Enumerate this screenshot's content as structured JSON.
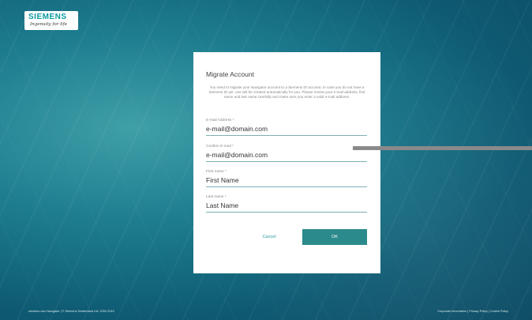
{
  "logo": {
    "word": "SIEMENS",
    "tagline": "Ingenuity for life"
  },
  "dialog": {
    "title": "Migrate Account",
    "description": "You need to migrate your Navigator account to a Siemens ID account. In case you do not have a Siemens ID yet, one will be created automatically for you. Please review your e-mail address, first name and last name carefully and make sure you enter a valid e-mail address.",
    "fields": [
      {
        "label": "E-mail Address *",
        "value": "e-mail@domain.com"
      },
      {
        "label": "Confirm E-mail *",
        "value": "e-mail@domain.com"
      },
      {
        "label": "First name *",
        "value": "First Name"
      },
      {
        "label": "Last name *",
        "value": "Last Name"
      }
    ],
    "cancel_label": "Cancel",
    "ok_label": "OK"
  },
  "footer": {
    "copyright": "siemens.com Navigator | © Siemens Switzerland Ltd. 2002-2019",
    "links": [
      "Corporate Information",
      "Privacy Policy",
      "Cookie Policy"
    ]
  },
  "colors": {
    "accent": "#2b8a8c",
    "background": "#1d7d8f"
  }
}
